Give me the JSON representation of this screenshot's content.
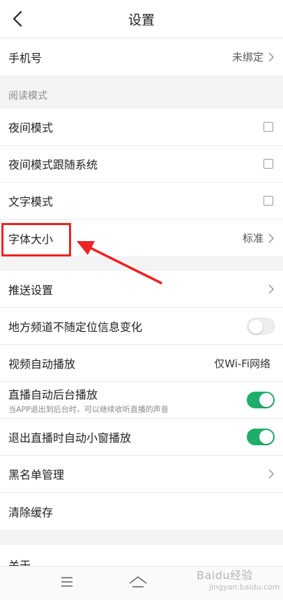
{
  "header": {
    "title": "设置"
  },
  "phone": {
    "label": "手机号",
    "value": "未绑定"
  },
  "reading_section": {
    "label": "阅读模式"
  },
  "reading_items": {
    "night": "夜间模式",
    "night_follow": "夜间模式跟随系统",
    "text_mode": "文字模式",
    "font_size": {
      "label": "字体大小",
      "value": "标准"
    }
  },
  "settings": {
    "push": "推送设置",
    "local_channel": "地方频道不随定位信息变化",
    "video_autoplay": {
      "label": "视频自动播放",
      "value": "仅Wi-Fi网络"
    },
    "live_background": {
      "label": "直播自动后台播放",
      "desc": "当APP退出到后台时，可以继续收听直播的声音"
    },
    "live_pip": "退出直播时自动小窗播放",
    "blacklist": "黑名单管理",
    "clear_cache": "清除缓存"
  },
  "about": {
    "label": "关于"
  },
  "toggles": {
    "local_channel": false,
    "live_background": true,
    "live_pip": true
  },
  "watermark": {
    "text": "Baidu经验",
    "sub": "jingyan.baidu.com"
  },
  "colors": {
    "accent": "#1fae6a",
    "highlight": "#ee2222"
  }
}
